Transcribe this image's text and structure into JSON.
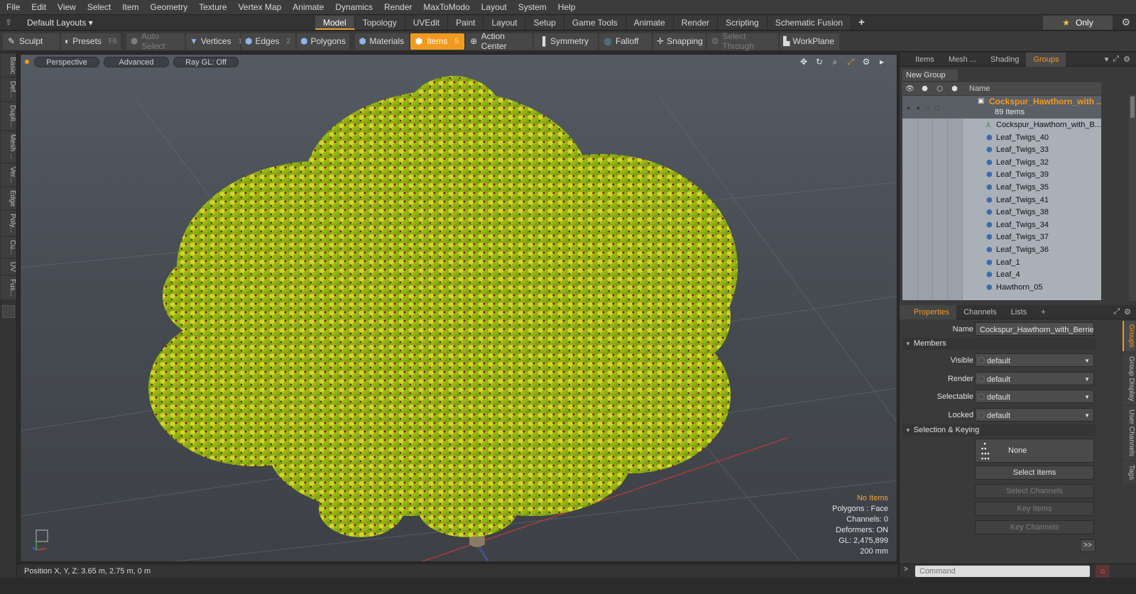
{
  "menu": [
    "File",
    "Edit",
    "View",
    "Select",
    "Item",
    "Geometry",
    "Texture",
    "Vertex Map",
    "Animate",
    "Dynamics",
    "Render",
    "MaxToModo",
    "Layout",
    "System",
    "Help"
  ],
  "layouts": {
    "current": "Default Layouts",
    "tabs": [
      "Model",
      "Topology",
      "UVEdit",
      "Paint",
      "Layout",
      "Setup",
      "Game Tools",
      "Animate",
      "Render",
      "Scripting",
      "Schematic Fusion"
    ],
    "active_tab": "Model",
    "plus": "+",
    "only_label": "Only"
  },
  "toolbar": {
    "sculpt": "Sculpt",
    "presets": "Presets",
    "presets_key": "F6",
    "auto_select": "Auto Select",
    "vertices": "Vertices",
    "vertices_key": "1",
    "edges": "Edges",
    "edges_key": "2",
    "polygons": "Polygons",
    "materials": "Materials",
    "items": "Items",
    "items_key": "5",
    "action_center": "Action Center",
    "symmetry": "Symmetry",
    "falloff": "Falloff",
    "snapping": "Snapping",
    "select_through": "Select Through",
    "workplane": "WorkPlane"
  },
  "left_tabs": [
    "Basic",
    "Def...",
    "Dupli...",
    "Mesh ...",
    "Ver...",
    "Edge",
    "Poly...",
    "Cu...",
    "UV",
    "Fus..."
  ],
  "viewport": {
    "perspective": "Perspective",
    "advanced": "Advanced",
    "raygl": "Ray GL: Off",
    "hud": {
      "items": "No Items",
      "polygons": "Polygons : Face",
      "channels": "Channels: 0",
      "deformers": "Deformers: ON",
      "gl": "GL: 2,475,899",
      "scale": "200 mm"
    }
  },
  "status": {
    "position": "Position X, Y, Z:   3.65 m, 2.75 m, 0 m"
  },
  "groups_panel": {
    "tabs": [
      "Items",
      "Mesh ...",
      "Shading",
      "Groups"
    ],
    "active_tab": "Groups",
    "new_group": "New Group",
    "name_header": "Name",
    "group": {
      "name": "Cockspur_Hawthorn_with ...",
      "count": "89 Items"
    },
    "items": [
      "Cockspur_Hawthorn_with_B...",
      "Leaf_Twigs_40",
      "Leaf_Twigs_33",
      "Leaf_Twigs_32",
      "Leaf_Twigs_39",
      "Leaf_Twigs_35",
      "Leaf_Twigs_41",
      "Leaf_Twigs_38",
      "Leaf_Twigs_34",
      "Leaf_Twigs_37",
      "Leaf_Twigs_36",
      "Leaf_1",
      "Leaf_4",
      "Hawthorn_05"
    ]
  },
  "properties": {
    "tabs": [
      "Properties",
      "Channels",
      "Lists"
    ],
    "active_tab": "Properties",
    "plus": "+",
    "name_label": "Name",
    "name_value": "Cockspur_Hawthorn_with_Berries",
    "members_section": "Members",
    "visible_label": "Visible",
    "visible_value": "default",
    "render_label": "Render",
    "render_value": "default",
    "selectable_label": "Selectable",
    "selectable_value": "default",
    "locked_label": "Locked",
    "locked_value": "default",
    "selection_section": "Selection & Keying",
    "none_label": "None",
    "select_items": "Select Items",
    "select_channels": "Select Channels",
    "key_items": "Key Items",
    "key_channels": "Key Channels",
    "more": ">>",
    "side_tabs": [
      "Groups",
      "Group Display",
      "User Channels",
      "Tags"
    ],
    "command_placeholder": "Command"
  },
  "colors": {
    "accent": "#f19a1f",
    "foliage": "#a8c21a",
    "berries": "#8a1a12"
  }
}
